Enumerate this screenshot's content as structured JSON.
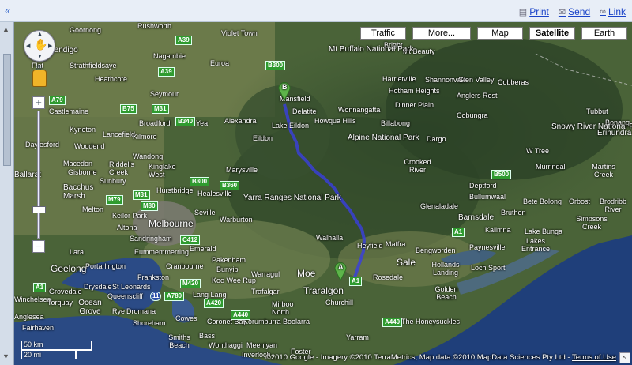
{
  "toolbar": {
    "collapse_icon": "double-chevron-left-icon",
    "print_label": "Print",
    "send_label": "Send",
    "link_label": "Link"
  },
  "map_type_buttons": [
    {
      "label": "Traffic",
      "selected": false
    },
    {
      "label": "More...",
      "selected": false
    },
    {
      "label": "Map",
      "selected": false
    },
    {
      "label": "Satellite",
      "selected": true
    },
    {
      "label": "Earth",
      "selected": false
    }
  ],
  "markers": {
    "start": "A",
    "end": "B"
  },
  "places": {
    "goornong": "Goornong",
    "rushworth": "Rushworth",
    "violet_town": "Violet Town",
    "bright": "Bright",
    "mt_beauty": "Mt Beauty",
    "bendigo": "Bendigo",
    "strathfieldsaye": "Strathfieldsaye",
    "nagambie": "Nagambie",
    "euroa": "Euroa",
    "mt_buffalo": "Mt Buffalo National Park",
    "flat": "Flat",
    "heathcote": "Heathcote",
    "seymour": "Seymour",
    "mansfield": "Mansfield",
    "harrietville": "Harrietville",
    "shannonvale": "Shannonvale",
    "glen_valley": "Glen Valley",
    "cobberas": "Cobberas",
    "hotham_heights": "Hotham Heights",
    "anglers_rest": "Anglers Rest",
    "dinner_plain": "Dinner Plain",
    "castlemaine": "Castlemaine",
    "delatite": "Delatite",
    "wonnangatta": "Wonnangatta",
    "tubbut": "Tubbut",
    "broadford": "Broadford",
    "yea": "Yea",
    "alexandra": "Alexandra",
    "lake_eildon": "Lake Eildon",
    "howqua_hills": "Howqua Hills",
    "billabong": "Billabong",
    "cobungra": "Cobungra",
    "bonang": "Bonang",
    "kyneton": "Kyneton",
    "lancefield": "Lancefield",
    "kilmore": "Kilmore",
    "snowy_river": "Snowy River National Park",
    "daylesford": "Daylesford",
    "woodend": "Woodend",
    "eildon": "Eildon",
    "alpine": "Alpine National Park",
    "dargo": "Dargo",
    "erinundra": "Erinundra National Park",
    "w_tree": "W Tree",
    "wandong": "Wandong",
    "macedon": "Macedon",
    "riddells_creek": "Riddells Creek",
    "kinglake_west": "Kinglake West",
    "gisborne": "Gisborne",
    "crooked_river": "Crooked River",
    "murrindal": "Murrindal",
    "martins_creek": "Martins Creek",
    "marysville": "Marysville",
    "ballarat": "Ballarat",
    "sunbury": "Sunbury",
    "deptford": "Deptford",
    "hurstbridge": "Hurstbridge",
    "bacchus_marsh": "Bacchus Marsh",
    "healesville": "Healesville",
    "yarra_ranges": "Yarra Ranges National Park",
    "bullumwaal": "Bullumwaal",
    "bete_bolong": "Bete Bolong",
    "orbost": "Orbost",
    "brodribb_river": "Brodribb River",
    "melton": "Melton",
    "keilor_park": "Keilor Park",
    "seville": "Seville",
    "glenaladale": "Glenaladale",
    "bruthen": "Bruthen",
    "melbourne": "Melbourne",
    "warburton": "Warburton",
    "barnsdale": "Barnsdale",
    "simpsons_creek": "Simpsons Creek",
    "altona": "Altona",
    "sandringham": "Sandringham",
    "kalimna": "Kalimna",
    "lake_bunga": "Lake Bunga",
    "lakes_entrance": "Lakes Entrance",
    "eummemmerring": "Eummemmerring",
    "walhalla": "Walhalla",
    "heyfield": "Heyfield",
    "maffra": "Maffra",
    "bengworden": "Bengworden",
    "paynesville": "Paynesville",
    "lara": "Lara",
    "emerald": "Emerald",
    "pakenham": "Pakenham",
    "portarlington": "Portarlington",
    "cranbourne": "Cranbourne",
    "bunyip": "Bunyip",
    "sale": "Sale",
    "geelong": "Geelong",
    "frankston": "Frankston",
    "warragul": "Warragul",
    "moe": "Moe",
    "holland_landing": "Hollands Landing",
    "loch_sport": "Loch Sport",
    "drysdale": "Drysdale",
    "st_leonards": "St Leonards",
    "koo_wee_rup": "Koo Wee Rup",
    "rosedale": "Rosedale",
    "grovedale": "Grovedale",
    "queenscliff": "Queenscliff",
    "trafalgar": "Trafalgar",
    "traralgon": "Traralgon",
    "golden_beach": "Golden Beach",
    "winchelsea": "Winchelsea",
    "torquay": "Torquay",
    "ocean_grove": "Ocean Grove",
    "lang_lang": "Lang Lang",
    "mirboo_north": "Mirboo North",
    "churchill": "Churchill",
    "anglesea": "Anglesea",
    "rye": "Rye",
    "dromana": "Dromana",
    "coronet_bay": "Coronet Bay",
    "korumburra": "Korumburra",
    "boolarra": "Boolarra",
    "the_honeysuckles": "The Honeysuckles",
    "fairhaven": "Fairhaven",
    "shoreham": "Shoreham",
    "cowes": "Cowes",
    "smiths_beach": "Smiths Beach",
    "bass": "Bass",
    "wonthaggi": "Wonthaggi",
    "meeniyan": "Meeniyan",
    "yarram": "Yarram",
    "foster": "Foster",
    "inverloch": "Inverloch"
  },
  "roads": [
    "A39",
    "B300",
    "A39",
    "A79",
    "B75",
    "M31",
    "B340",
    "B300",
    "B360",
    "M79",
    "M31",
    "M80",
    "C412",
    "M420",
    "A780",
    "11",
    "A420",
    "A440",
    "A1",
    "A1",
    "A1",
    "A1",
    "B500",
    "A440",
    "A1"
  ],
  "controls": {
    "pan_icon": "hand-pan-icon",
    "pegman_icon": "street-view-pegman-icon",
    "zoom_in": "+",
    "zoom_out": "−",
    "zoom_level_fraction": 0.78
  },
  "scale": {
    "km": "50 km",
    "mi": "20 mi"
  },
  "attribution": {
    "text": "©2010 Google - Imagery ©2010 TerraMetrics, Map data ©2010 MapData Sciences Pty Ltd - ",
    "terms": "Terms of Use"
  },
  "colors": {
    "route": "#3a3ee0",
    "marker": "#5db54a",
    "road_shield": "#2f9b2f",
    "water": "#2b4b86"
  }
}
